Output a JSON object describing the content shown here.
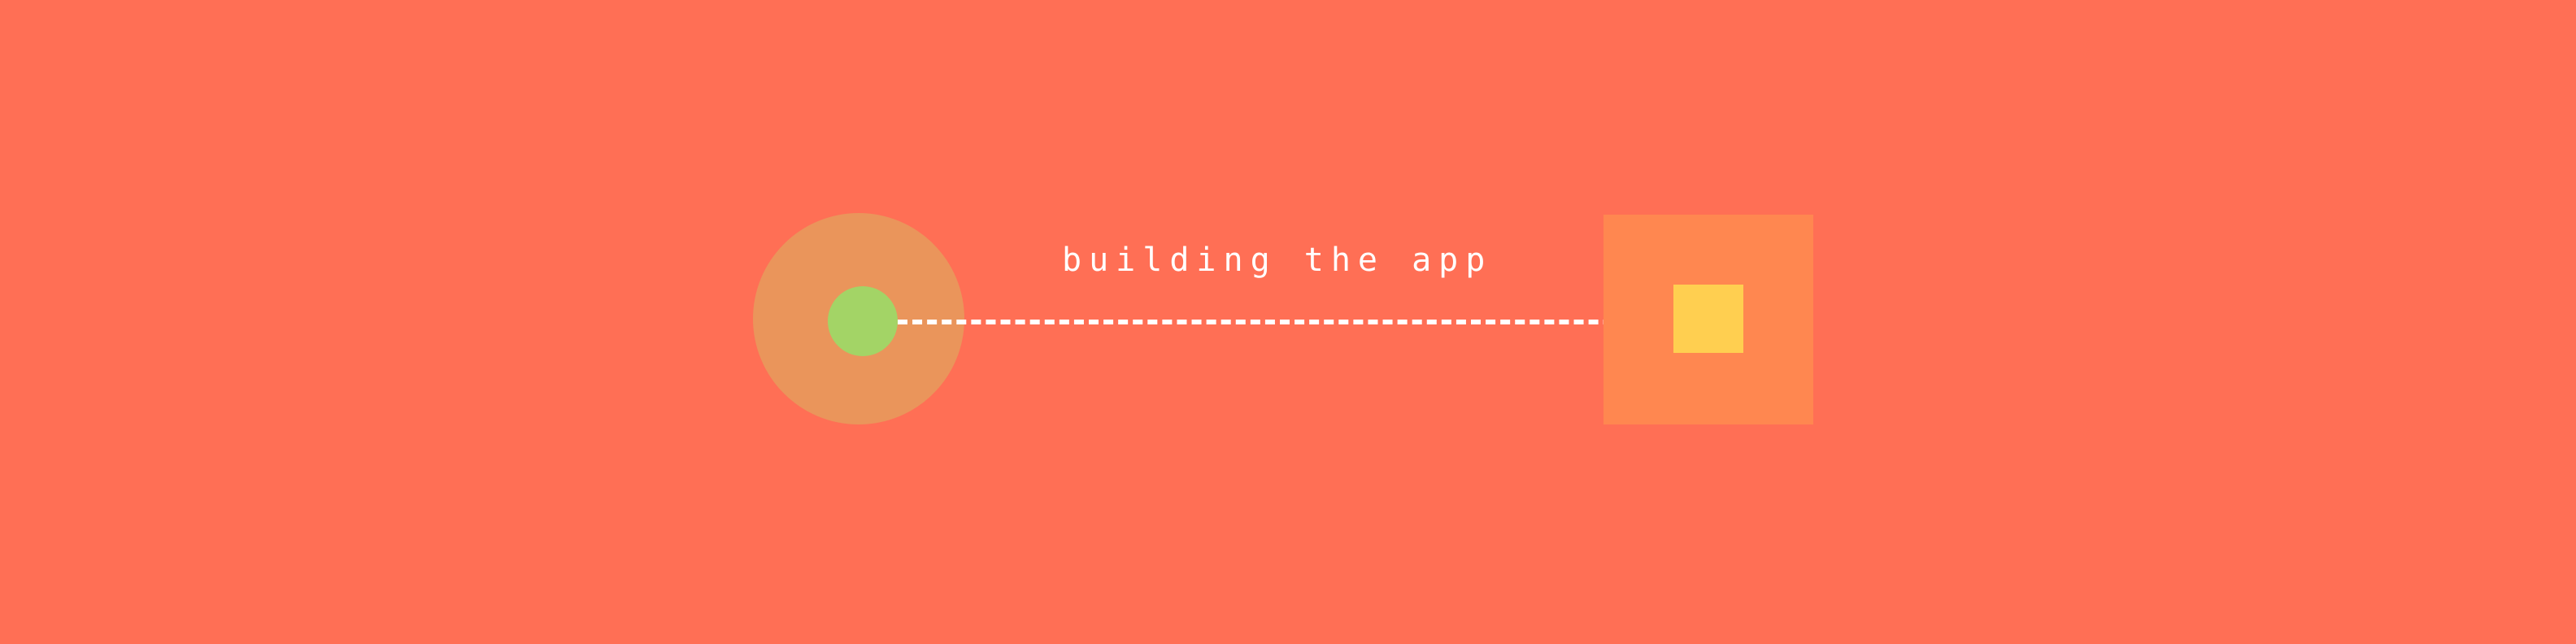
{
  "caption": "building the app",
  "colors": {
    "background": "#FF6F55",
    "start_halo": "#EA955B",
    "start_dot": "#A3D466",
    "connector": "#FFFFFF",
    "end_box": "#FF8750",
    "end_square": "#FFCF50",
    "caption_text": "#FFFFFF"
  },
  "icons": {
    "start": "circle-icon",
    "end": "square-icon"
  }
}
